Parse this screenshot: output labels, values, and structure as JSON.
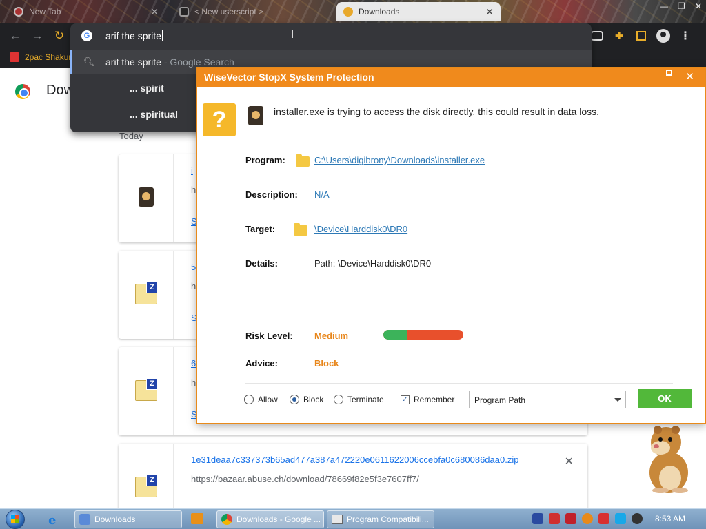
{
  "browser": {
    "tabs": [
      {
        "label": "New Tab"
      },
      {
        "label": "< New userscript >"
      },
      {
        "label": "Downloads",
        "active": true
      }
    ],
    "omnibox": {
      "query": "arif the sprite",
      "suggestions": [
        {
          "text": "arif the sprite",
          "suffix": " - Google Search"
        },
        {
          "text": "... spirit",
          "suffix": ""
        },
        {
          "text": "... spiritual",
          "suffix": ""
        }
      ]
    },
    "bookmark": "2pac Shakur"
  },
  "page": {
    "title": "Downloads",
    "date_group": "Today",
    "cards": [
      {
        "name": "i",
        "source": "h",
        "action": "S",
        "icon": "exe-icon"
      },
      {
        "name": "5",
        "source": "h",
        "action": "S",
        "icon": "zip-icon"
      },
      {
        "name": "6",
        "source": "h",
        "action": "S",
        "icon": "zip-icon"
      },
      {
        "name": "1e31deaa7c337373b65ad477a387a472220e0611622006ccebfa0c680086daa0.zip",
        "source": "https://bazaar.abuse.ch/download/78669f82e5f3e7607ff7/",
        "action": "",
        "icon": "zip-icon"
      }
    ]
  },
  "dialog": {
    "title": "WiseVector StopX System Protection",
    "message": "installer.exe is trying to access the disk directly, this could result in data loss.",
    "program_label": "Program:",
    "program_value": "C:\\Users\\digibrony\\Downloads\\installer.exe",
    "description_label": "Description:",
    "description_value": "N/A",
    "target_label": "Target:",
    "target_value": "\\Device\\Harddisk0\\DR0",
    "details_label": "Details:",
    "details_value": "Path: \\Device\\Harddisk0\\DR0",
    "risk_label": "Risk Level:",
    "risk_value": "Medium",
    "risk_fraction": 0.3,
    "advice_label": "Advice:",
    "advice_value": "Block",
    "options": [
      {
        "label": "Allow",
        "checked": false
      },
      {
        "label": "Block",
        "checked": true
      },
      {
        "label": "Terminate",
        "checked": false
      }
    ],
    "remember_label": "Remember",
    "remember_checked": true,
    "scope_value": "Program Path",
    "ok_label": "OK",
    "colors": {
      "title_bar": "#f08a1c",
      "ok": "#52b83a",
      "link": "#2d79b6"
    }
  },
  "taskbar": {
    "buttons": [
      {
        "label": "Downloads"
      },
      {
        "label": "Downloads - Google ..."
      },
      {
        "label": "Program Compatibili..."
      }
    ],
    "clock": "8:53 AM"
  }
}
